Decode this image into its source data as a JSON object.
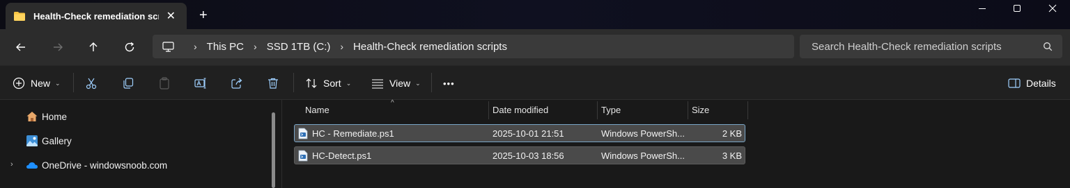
{
  "window": {
    "tab_title": "Health-Check remediation scri",
    "tab_close": "✕",
    "new_tab": "+",
    "controls": [
      "minimize-icon",
      "maximize-icon",
      "close-icon"
    ]
  },
  "nav": {
    "back": "back-arrow-icon",
    "forward": "forward-arrow-icon",
    "up": "up-arrow-icon",
    "refresh": "refresh-icon",
    "breadcrumbs": [
      "This PC",
      "SSD 1TB (C:)",
      "Health-Check remediation scripts"
    ],
    "search_placeholder": "Search Health-Check remediation scripts"
  },
  "toolbar": {
    "new_label": "New",
    "sort_label": "Sort",
    "view_label": "View",
    "details_label": "Details",
    "more": "•••"
  },
  "sidebar": {
    "items": [
      {
        "label": "Home",
        "icon": "home-icon"
      },
      {
        "label": "Gallery",
        "icon": "gallery-icon"
      },
      {
        "label": "OneDrive - windowsnoob.com",
        "icon": "onedrive-icon"
      }
    ]
  },
  "columns": [
    "Name",
    "Date modified",
    "Type",
    "Size"
  ],
  "files": [
    {
      "name": "HC - Remediate.ps1",
      "date": "2025-10-01 21:51",
      "type": "Windows PowerSh...",
      "size": "2 KB"
    },
    {
      "name": "HC-Detect.ps1",
      "date": "2025-10-03 18:56",
      "type": "Windows PowerSh...",
      "size": "3 KB"
    }
  ],
  "colors": {
    "folder": "#f6c443",
    "accent": "#4fa3e0",
    "selected_row": "#4a4a4a"
  }
}
